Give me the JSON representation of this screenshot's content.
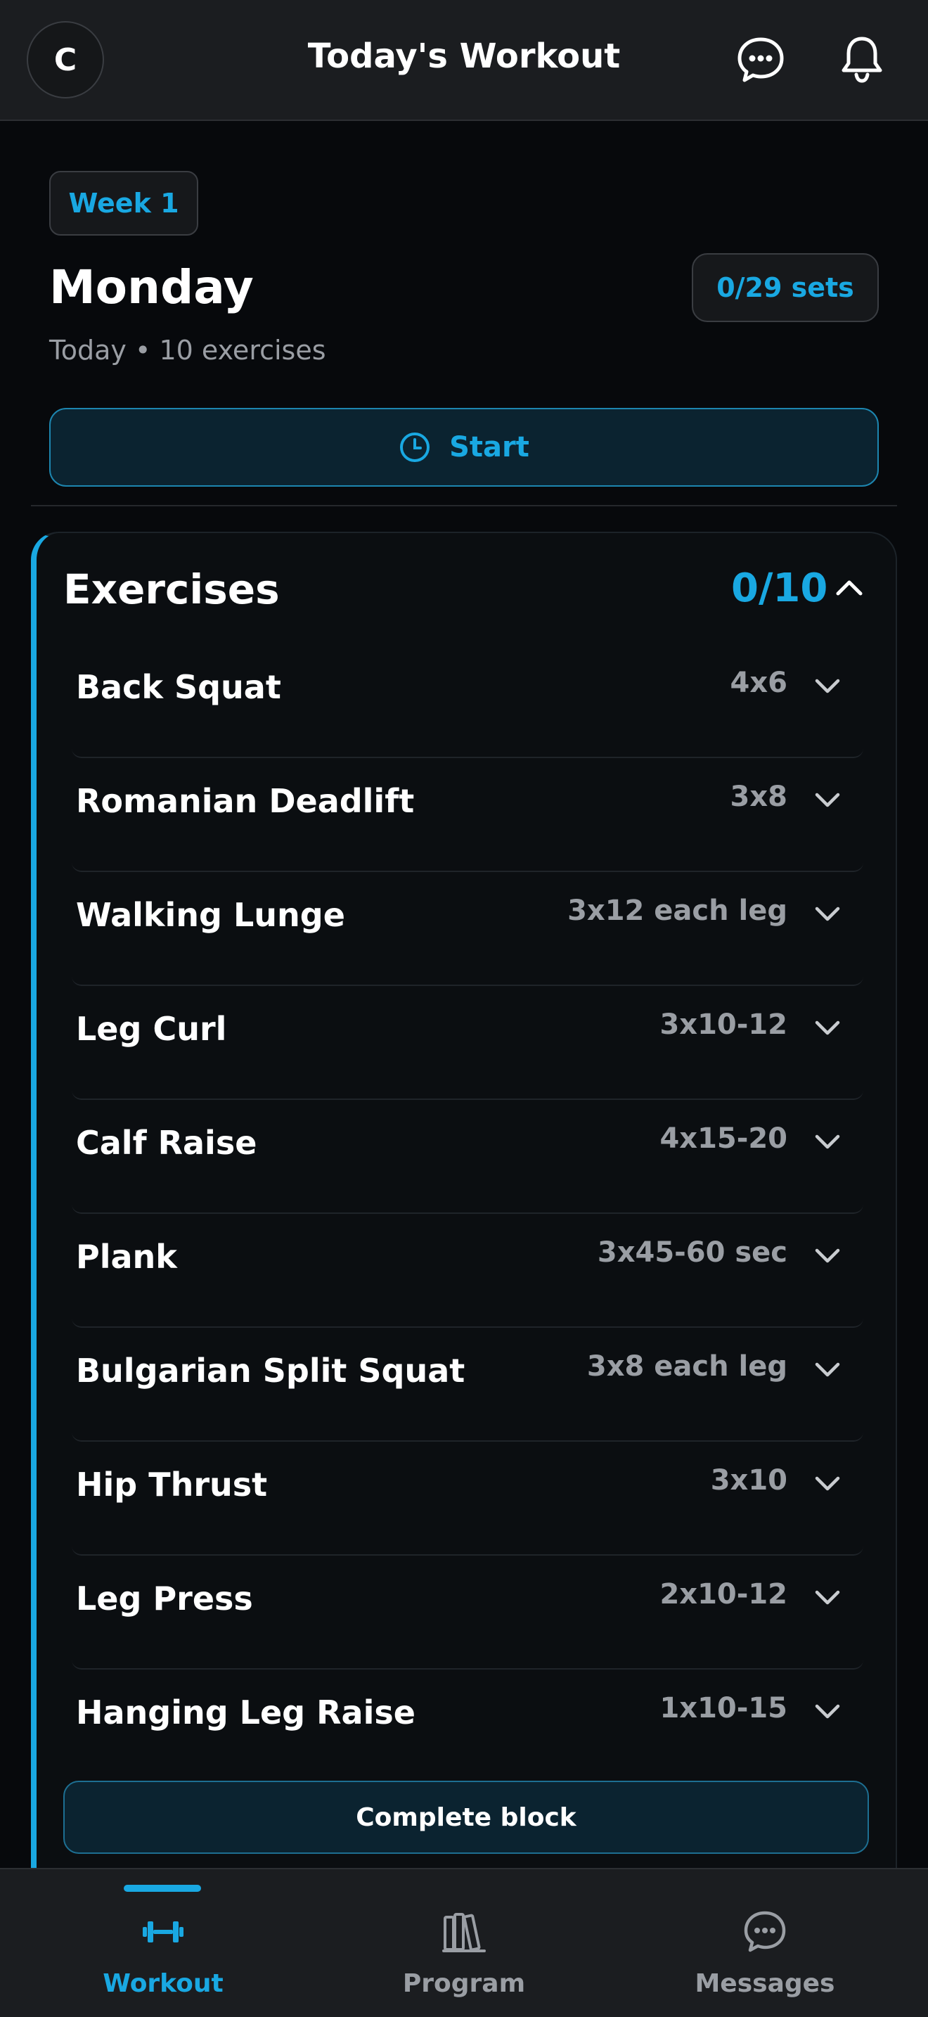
{
  "header": {
    "avatar_initial": "C",
    "title": "Today's Workout",
    "chat_icon": "chat-bubble-icon",
    "bell_icon": "bell-icon"
  },
  "week": {
    "label": "Week 1"
  },
  "day": {
    "title": "Monday",
    "subtitle": "Today • 10 exercises",
    "sets_progress": "0/29 sets"
  },
  "start_button": {
    "label": "Start",
    "icon": "clock-icon"
  },
  "exercises": {
    "title": "Exercises",
    "count": "0/10",
    "items": [
      {
        "name": "Back Squat",
        "sets": "4x6"
      },
      {
        "name": "Romanian Deadlift",
        "sets": "3x8"
      },
      {
        "name": "Walking Lunge",
        "sets": "3x12 each leg"
      },
      {
        "name": "Leg Curl",
        "sets": "3x10-12"
      },
      {
        "name": "Calf Raise",
        "sets": "4x15-20"
      },
      {
        "name": "Plank",
        "sets": "3x45-60 sec"
      },
      {
        "name": "Bulgarian Split Squat",
        "sets": "3x8 each leg"
      },
      {
        "name": "Hip Thrust",
        "sets": "3x10"
      },
      {
        "name": "Leg Press",
        "sets": "2x10-12"
      },
      {
        "name": "Hanging Leg Raise",
        "sets": "1x10-15"
      }
    ],
    "complete_label": "Complete block"
  },
  "nav": {
    "items": [
      {
        "label": "Workout",
        "icon": "dumbbell-icon",
        "active": true
      },
      {
        "label": "Program",
        "icon": "books-icon",
        "active": false
      },
      {
        "label": "Messages",
        "icon": "chat-bubble-icon",
        "active": false
      }
    ]
  },
  "colors": {
    "accent": "#19a8e2",
    "background": "#07090c",
    "surface": "#1b1d20",
    "muted_text": "#9a9ea4"
  }
}
